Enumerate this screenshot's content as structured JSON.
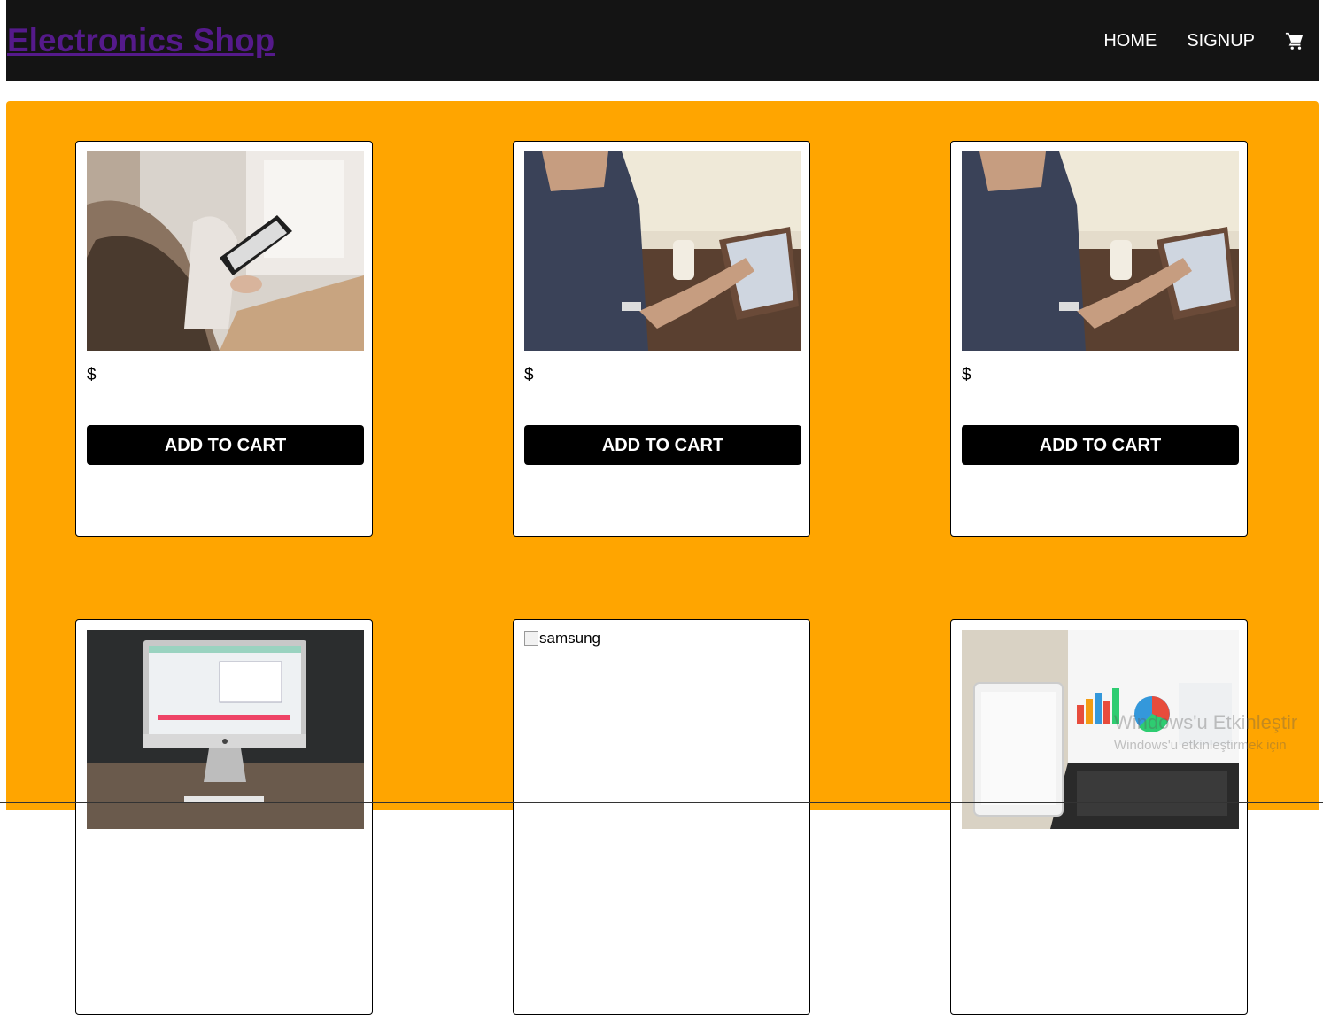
{
  "header": {
    "brand": "Electronics Shop",
    "nav": {
      "home": "HOME",
      "signup": "SIGNUP"
    },
    "cart_icon": "shopping-cart-icon",
    "background": "#141414",
    "brand_color": "#551a8b"
  },
  "main": {
    "background": "#ffa500"
  },
  "products": [
    {
      "image": "tablet-reader-photo",
      "price": "$",
      "button": "ADD TO CART"
    },
    {
      "image": "man-using-tablet-photo",
      "price": "$",
      "button": "ADD TO CART"
    },
    {
      "image": "man-using-tablet-photo",
      "price": "$",
      "button": "ADD TO CART"
    },
    {
      "image": "desktop-computer-photo"
    },
    {
      "image_alt": "samsung"
    },
    {
      "image": "laptop-tablet-charts-photo"
    }
  ],
  "watermark": {
    "line1": "Windows'u Etkinleştir",
    "line2": "Windows'u etkinleştirmek için"
  }
}
